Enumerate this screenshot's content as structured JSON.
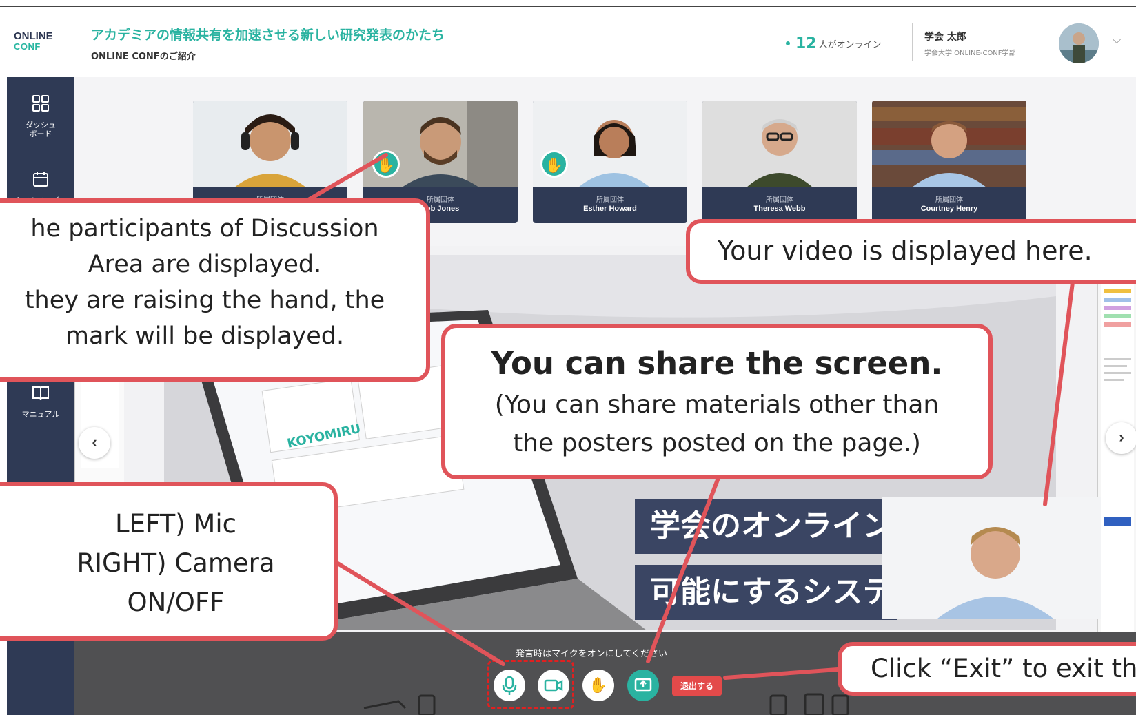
{
  "header": {
    "logo_line1": "ONLINE",
    "logo_line2": "CONF",
    "title": "アカデミアの情報共有を加速させる新しい研究発表のかたち",
    "subtitle": "ONLINE CONFのご紹介",
    "online_count": "12",
    "online_text": "人がオンライン",
    "user_name": "学会 太郎",
    "user_affiliation": "学会大学 ONLINE-CONF学部"
  },
  "sidebar": {
    "items": [
      {
        "label": "ダッシュ\nボード",
        "icon": "dashboard-grid-icon"
      },
      {
        "label": "タイムテーブル",
        "icon": "calendar-icon"
      },
      {
        "label": "マニュアル",
        "icon": "book-icon"
      }
    ]
  },
  "participants": [
    {
      "affiliation": "所属団体",
      "name": "",
      "hand_raised": false
    },
    {
      "affiliation": "所属団体",
      "name": "cob Jones",
      "hand_raised": true
    },
    {
      "affiliation": "所属団体",
      "name": "Esther Howard",
      "hand_raised": true
    },
    {
      "affiliation": "所属団体",
      "name": "Theresa Webb",
      "hand_raised": false
    },
    {
      "affiliation": "所属団体",
      "name": "Courtney Henry",
      "hand_raised": false
    }
  ],
  "slide": {
    "brand": "KOYOMIRU",
    "banner1": "学会のオンライン",
    "banner2": "可能にするシステ"
  },
  "controls": {
    "hint": "発言時はマイクをオンにしてください",
    "exit_label": "退出する"
  },
  "callouts": {
    "participants": [
      "he participants of Discussion",
      "Area are displayed.",
      "they are raising the hand, the",
      "mark will be displayed."
    ],
    "video": "Your video is displayed here.",
    "share_title": "You can share the screen.",
    "share_lines": [
      "(You can share materials other than",
      "the posters posted on the page.)"
    ],
    "mic_camera": [
      "LEFT) Mic",
      "RIGHT) Camera",
      "ON/OFF"
    ],
    "exit": "Click “Exit” to exit the"
  },
  "colors": {
    "accent": "#2ab3a1",
    "navy": "#2f3a55",
    "callout_border": "#e0545a",
    "exit_red": "#e34a4a"
  }
}
